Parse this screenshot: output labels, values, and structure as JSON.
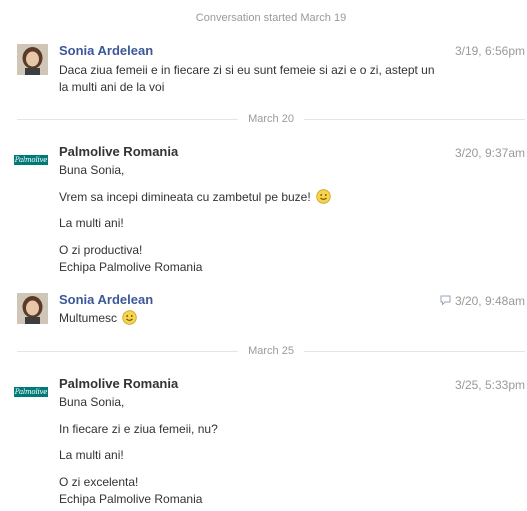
{
  "thread": {
    "start_label": "Conversation started March 19",
    "messages": [
      {
        "author": "Sonia Ardelean",
        "time": "3/19, 6:56pm",
        "lines": [
          "Daca ziua femeii e in fiecare zi si eu sunt femeie si azi e o zi, astept un",
          "la multi ani de la voi"
        ]
      },
      {
        "divider": "March 20",
        "author": "Palmolive Romania",
        "logo_text": "Palmolive",
        "time": "3/20, 9:37am",
        "lines": [
          "Buna Sonia,",
          "Vrem sa incepi dimineata cu zambetul pe buze!",
          "La multi ani!",
          "O zi productiva!",
          "Echipa Palmolive Romania"
        ]
      },
      {
        "author": "Sonia Ardelean",
        "time": "3/20, 9:48am",
        "lines": [
          "Multumesc"
        ]
      },
      {
        "divider": "March 25",
        "author": "Palmolive Romania",
        "logo_text": "Palmolive",
        "time": "3/25, 5:33pm",
        "lines": [
          "Buna Sonia,",
          "In fiecare zi e ziua femeii, nu?",
          "La multi ani!",
          "O zi excelenta!",
          "Echipa Palmolive Romania"
        ]
      }
    ]
  },
  "colors": {
    "user_name": "#3b5998",
    "page_name": "#333333",
    "meta_text": "#999999",
    "divider": "#e5e5e5",
    "brand_logo": "#007a78"
  },
  "icons": [
    "smiley-emoji-icon",
    "reply-icon",
    "avatar-photo",
    "palmolive-logo"
  ]
}
